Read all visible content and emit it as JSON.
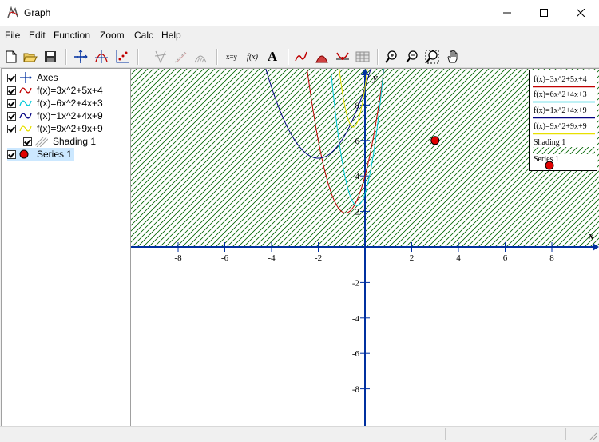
{
  "window": {
    "title": "Graph"
  },
  "menu": [
    "File",
    "Edit",
    "Function",
    "Zoom",
    "Calc",
    "Help"
  ],
  "tree": {
    "items": [
      {
        "label": "Axes",
        "icon": "axes-icon",
        "checked": true
      },
      {
        "label": "f(x)=3x^2+5x+4",
        "icon": "curve-icon",
        "color": "#c00000",
        "checked": true
      },
      {
        "label": "f(x)=6x^2+4x+3",
        "icon": "curve-icon",
        "color": "#00c8d8",
        "checked": true
      },
      {
        "label": "f(x)=1x^2+4x+9",
        "icon": "curve-icon",
        "color": "#000080",
        "checked": true
      },
      {
        "label": "f(x)=9x^2+9x+9",
        "icon": "curve-icon",
        "color": "#e8e000",
        "checked": true
      },
      {
        "label": "Shading 1",
        "icon": "shading-icon",
        "checked": true
      },
      {
        "label": "Series 1",
        "icon": "series-point-icon",
        "color": "#e00000",
        "checked": true
      }
    ]
  },
  "graph": {
    "x_axis_label": "x",
    "y_axis_label": "y",
    "x_ticks": [
      "-8",
      "-6",
      "-4",
      "-2",
      "2",
      "4",
      "6",
      "8"
    ],
    "y_ticks": [
      "2",
      "4",
      "6",
      "8",
      "-2",
      "-4",
      "-6",
      "-8"
    ],
    "functions": [
      {
        "name": "f(x)=3x^2+5x+4",
        "a": 3,
        "b": 5,
        "c": 4,
        "color": "#c00000"
      },
      {
        "name": "f(x)=6x^2+4x+3",
        "a": 6,
        "b": 4,
        "c": 3,
        "color": "#00c8d8"
      },
      {
        "name": "f(x)=1x^2+4x+9",
        "a": 1,
        "b": 4,
        "c": 9,
        "color": "#000080"
      },
      {
        "name": "f(x)=9x^2+9x+9",
        "a": 9,
        "b": 9,
        "c": 9,
        "color": "#e8e000"
      }
    ],
    "series_points": [
      {
        "x": 3,
        "y": 6
      }
    ],
    "shading_color": "#006400",
    "axis_color": "#0030a0"
  },
  "legend": {
    "entries": [
      {
        "label": "f(x)=3x^2+5x+4",
        "color": "#c00000"
      },
      {
        "label": "f(x)=6x^2+4x+3",
        "color": "#00c8d8"
      },
      {
        "label": "f(x)=1x^2+4x+9",
        "color": "#000080"
      },
      {
        "label": "f(x)=9x^2+9x+9",
        "color": "#e8e000"
      },
      {
        "label": "Shading 1",
        "color": "#006400"
      },
      {
        "label": "Series 1",
        "color": "#e00000"
      }
    ]
  },
  "toolbar": {
    "xy_label": "x=y",
    "fx_label": "f(x)",
    "text_label": "A"
  }
}
